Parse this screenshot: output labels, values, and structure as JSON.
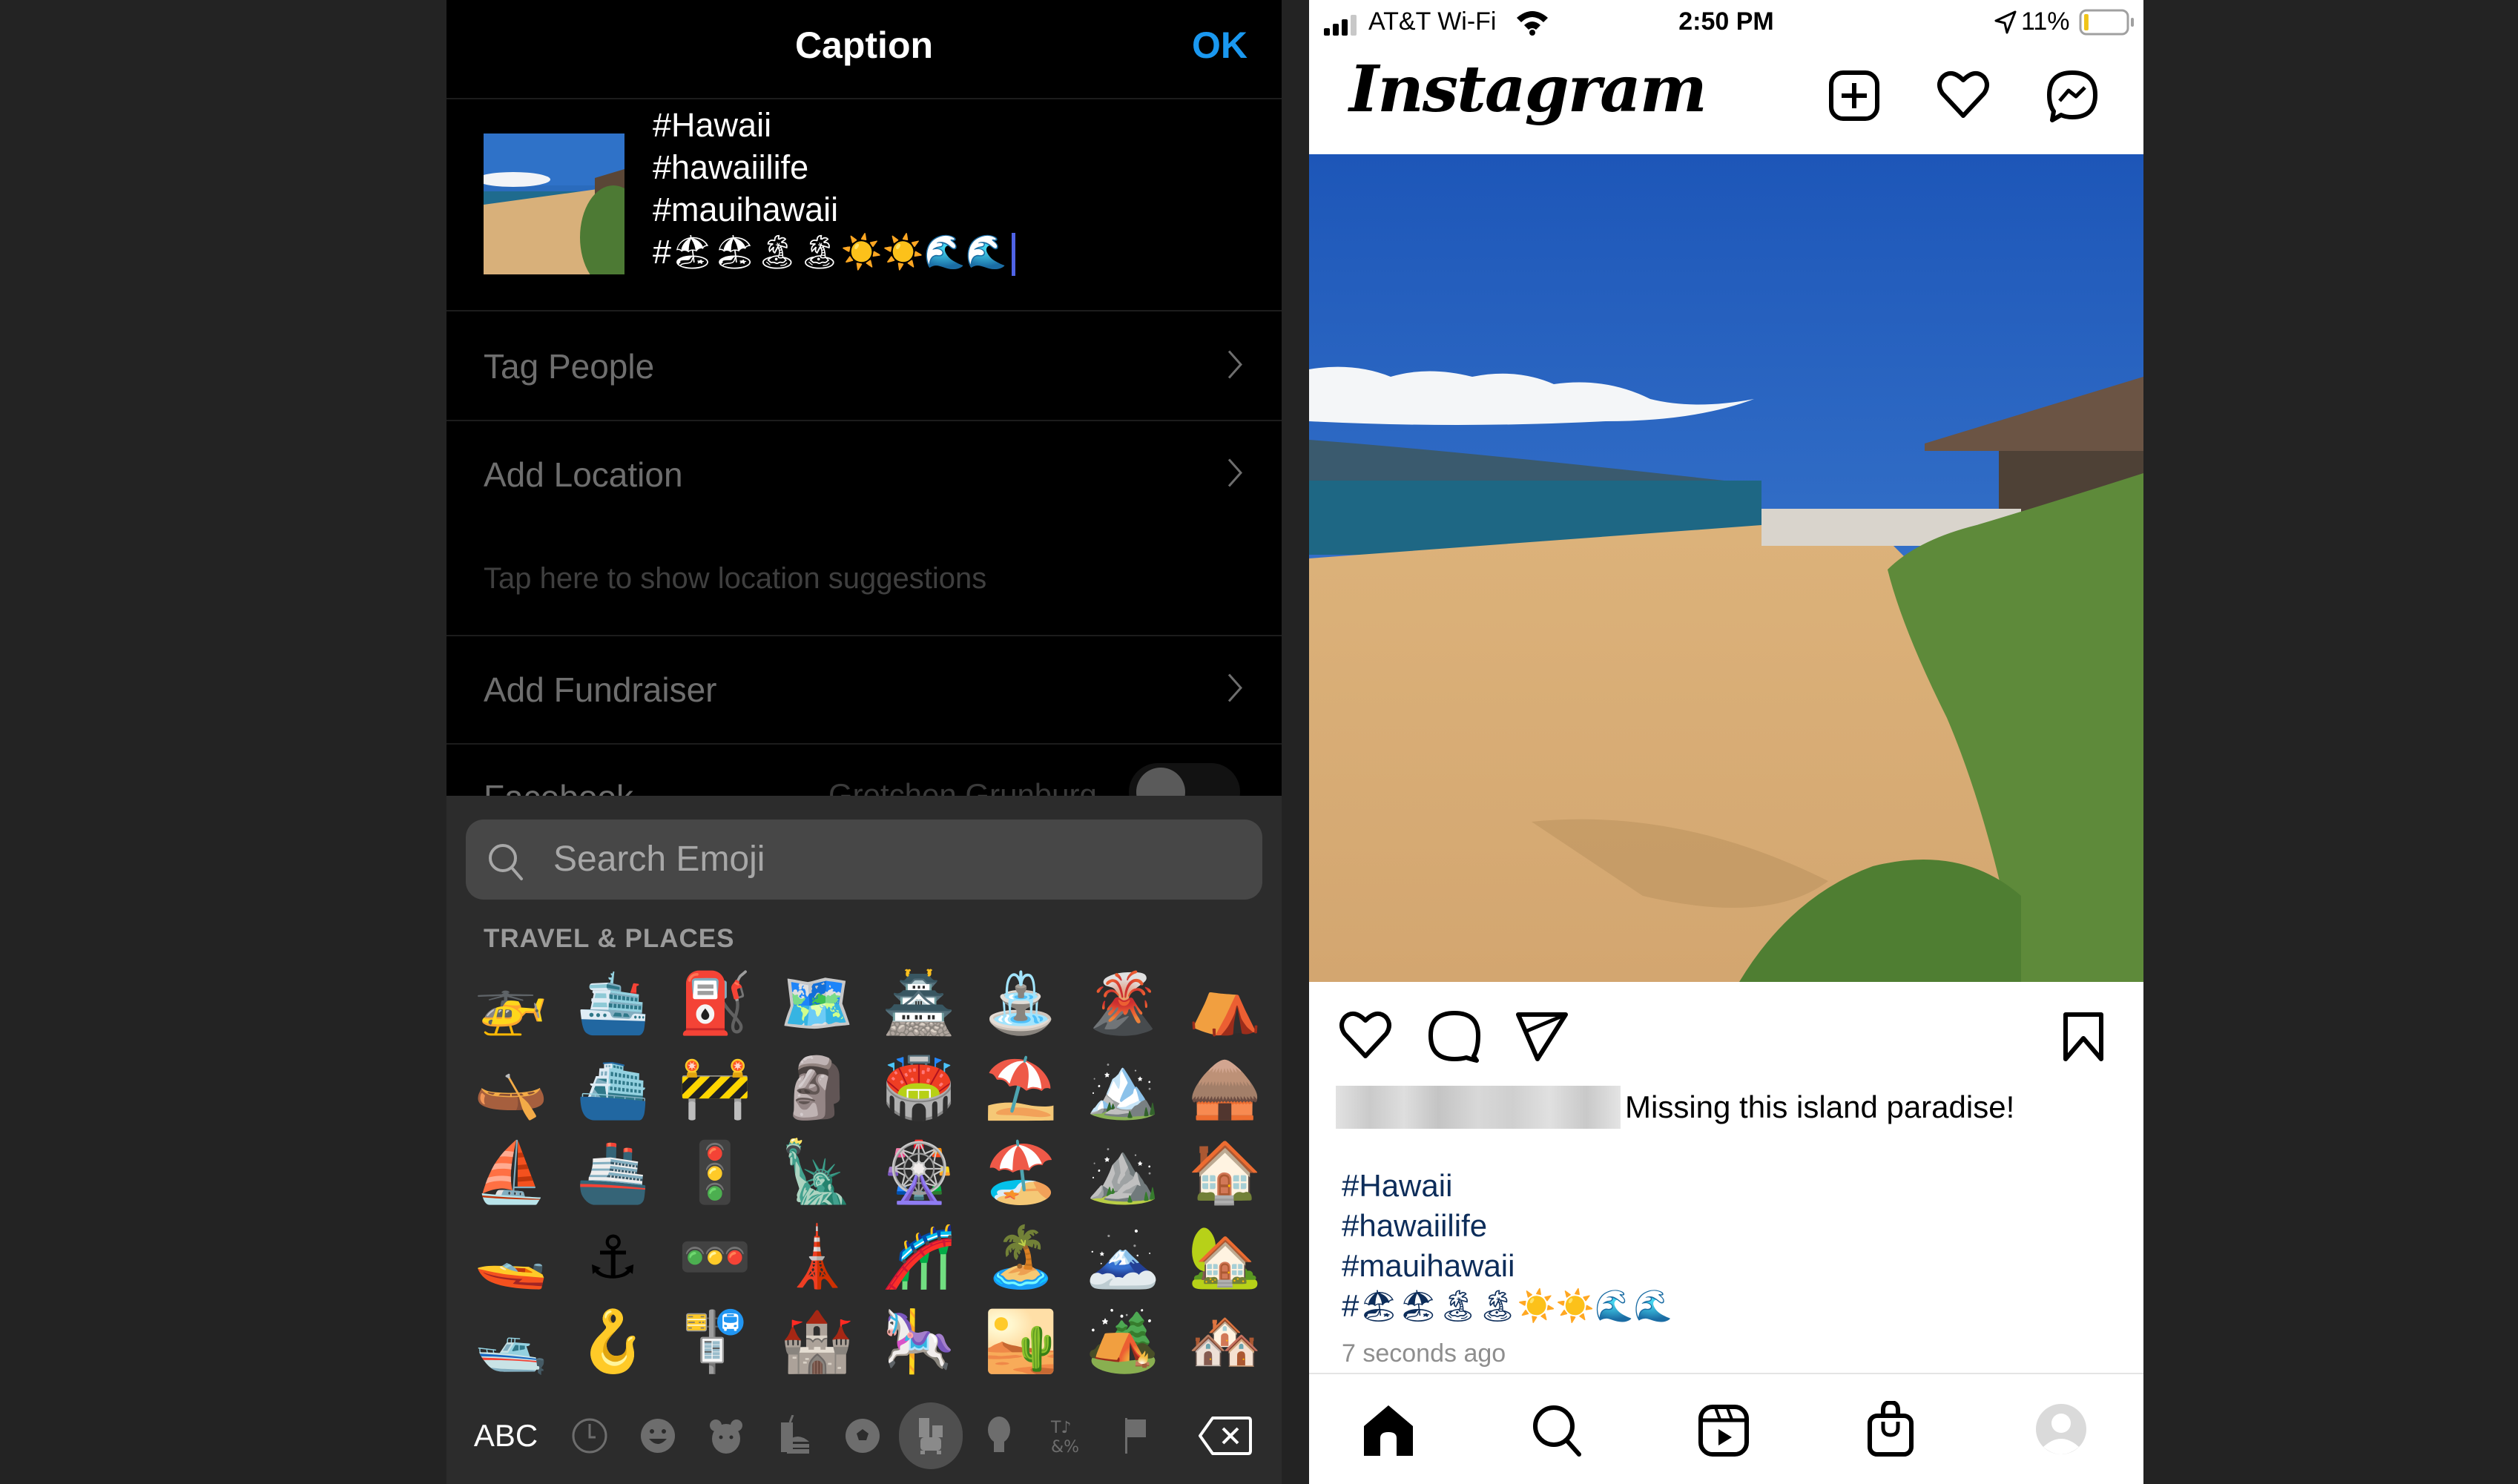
{
  "caption_screen": {
    "title": "Caption",
    "ok_label": "OK",
    "caption_lines": [
      "#Hawaii",
      "#hawaiilife",
      "#mauihawaii",
      "#🏖🏖🏝🏝☀️☀️🌊🌊"
    ],
    "menu": [
      {
        "label": "Tag People"
      },
      {
        "label": "Add Location"
      },
      {
        "label": "Add Fundraiser"
      }
    ],
    "location_suggestions": "Tap here to show location suggestions",
    "facebook": {
      "label": "Facebook",
      "account": "Gretchen Grunburg",
      "toggle_on": false
    }
  },
  "emoji_keyboard": {
    "search_placeholder": "Search Emoji",
    "category_label": "TRAVEL & PLACES",
    "grid": [
      [
        "🚁",
        "🛳️",
        "⛽",
        "🗺️",
        "🏯",
        "⛲",
        "🌋",
        "⛺"
      ],
      [
        "🛶",
        "⛴️",
        "🚧",
        "🗿",
        "🏟️",
        "⛱️",
        "🏔️",
        "🛖"
      ],
      [
        "⛵",
        "🚢",
        "🚦",
        "🗽",
        "🎡",
        "🏖️",
        "⛰️",
        "🏠"
      ],
      [
        "🚤",
        "⚓",
        "🚥",
        "🗼",
        "🎢",
        "🏝️",
        "🗻",
        "🏡"
      ],
      [
        "🛥️",
        "🪝",
        "🚏",
        "🏰",
        "🎠",
        "🏜️",
        "🏕️",
        "🏘️"
      ]
    ],
    "abc_label": "ABC",
    "categories": [
      "recent-icon",
      "smileys-icon",
      "animals-icon",
      "food-icon",
      "activity-icon",
      "travel-icon",
      "objects-icon",
      "symbols-icon",
      "flags-icon"
    ],
    "selected_category": "travel-icon"
  },
  "instagram": {
    "status_bar": {
      "carrier": "AT&T Wi-Fi",
      "time": "2:50 PM",
      "battery": "11%",
      "battery_level": 0.11
    },
    "logo": "Instagram",
    "header_icons": [
      "new-post-icon",
      "activity-heart-icon",
      "messenger-icon"
    ],
    "post": {
      "caption": "Missing this island paradise!",
      "hashtags": [
        "#Hawaii",
        "#hawaiilife",
        "#mauihawaii",
        "#🏖🏖🏝🏝☀️☀️🌊🌊"
      ],
      "time_ago": "7 seconds ago"
    },
    "tabs": [
      "home-icon",
      "search-icon",
      "reels-icon",
      "shop-icon",
      "profile-icon"
    ],
    "active_tab": "home-icon"
  }
}
